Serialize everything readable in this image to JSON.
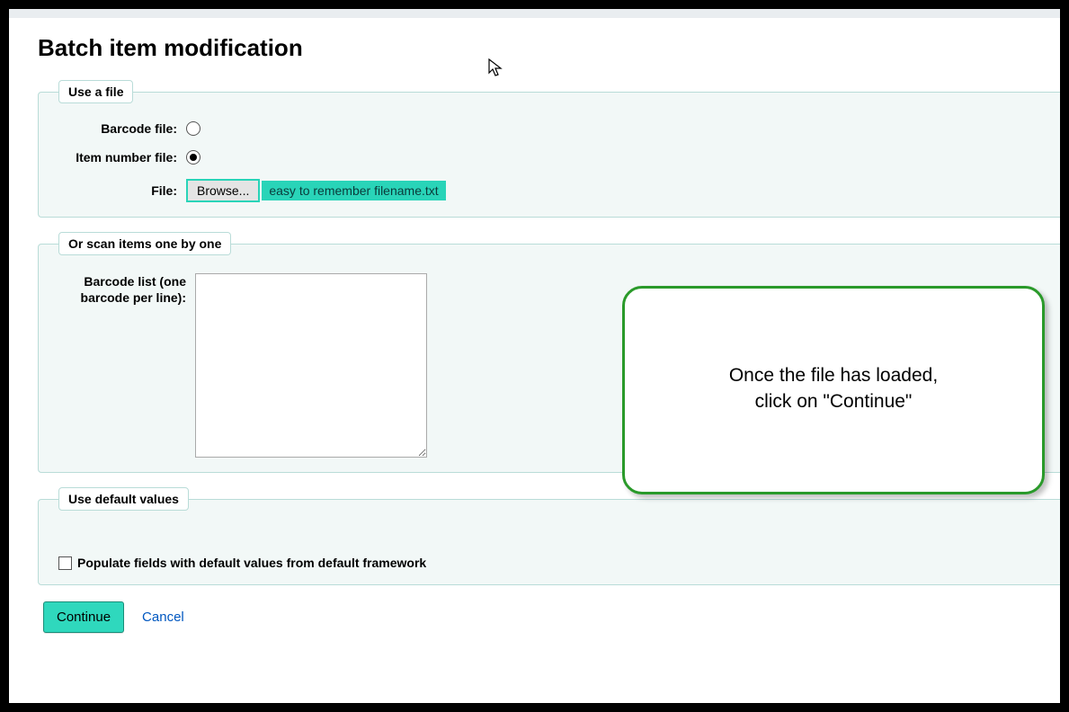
{
  "page_title": "Batch item modification",
  "fieldset_file": {
    "legend": "Use a file",
    "barcode_file_label": "Barcode file:",
    "item_number_file_label": "Item number file:",
    "file_label": "File:",
    "browse_button": "Browse...",
    "selected_filename": "easy to remember filename.txt",
    "selected_radio": "item_number"
  },
  "fieldset_scan": {
    "legend": "Or scan items one by one",
    "barcode_list_label": "Barcode list (one barcode per line):",
    "barcode_list_value": ""
  },
  "fieldset_defaults": {
    "legend": "Use default values",
    "checkbox_label": "Populate fields with default values from default framework",
    "checkbox_checked": false
  },
  "actions": {
    "continue_label": "Continue",
    "cancel_label": "Cancel"
  },
  "callout": {
    "line1": "Once the file has loaded,",
    "line2": "click on \"Continue\""
  }
}
